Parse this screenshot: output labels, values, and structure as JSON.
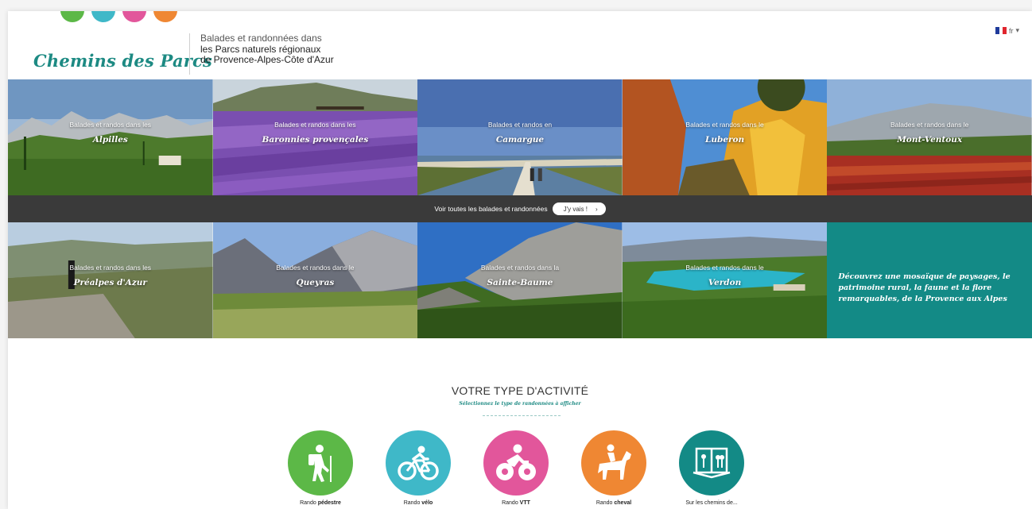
{
  "header": {
    "logo": "Chemins des Parcs",
    "tagline_1": "Balades et randonnées dans",
    "tagline_2": "les Parcs naturels régionaux",
    "tagline_3": "de Provence-Alpes-Côte d'Azur",
    "lang": "fr",
    "dots": [
      "#5cb847",
      "#3fb8c8",
      "#e2569b",
      "#ef8733"
    ]
  },
  "tiles_row1": [
    {
      "caption": "Balades et randos dans les",
      "name": "Alpilles"
    },
    {
      "caption": "Balades et randos dans les",
      "name": "Baronnies provençales"
    },
    {
      "caption": "Balades et randos en",
      "name": "Camargue"
    },
    {
      "caption": "Balades et randos dans le",
      "name": "Luberon"
    },
    {
      "caption": "Balades et randos dans le",
      "name": "Mont-Ventoux"
    }
  ],
  "band": {
    "text": "Voir toutes les balades et randonnées",
    "button": "J'y vais !",
    "chevron": "›"
  },
  "tiles_row2": [
    {
      "caption": "Balades et randos dans les",
      "name": "Préalpes d'Azur"
    },
    {
      "caption": "Balades et randos dans le",
      "name": "Queyras"
    },
    {
      "caption": "Balades et randos dans la",
      "name": "Sainte-Baume"
    },
    {
      "caption": "Balades et randos dans le",
      "name": "Verdon"
    }
  ],
  "promo": "Découvrez une mosaïque de paysages, le patrimoine rural, la faune et la flore remarquables, de la Provence aux Alpes",
  "activities": {
    "title": "VOTRE TYPE D'ACTIVITÉ",
    "subtitle": "Sélectionnez le type de randonnées à afficher",
    "items": [
      {
        "prefix": "Rando ",
        "bold": "pédestre",
        "color": "#5cb847",
        "icon": "hiker-icon"
      },
      {
        "prefix": "Rando ",
        "bold": "vélo",
        "color": "#3fb8c8",
        "icon": "bicycle-icon"
      },
      {
        "prefix": "Rando ",
        "bold": "VTT",
        "color": "#e2569b",
        "icon": "mountain-bike-icon"
      },
      {
        "prefix": "Rando ",
        "bold": "cheval",
        "color": "#ef8733",
        "icon": "horse-rider-icon"
      },
      {
        "prefix": "Sur les chemins de...",
        "bold": "",
        "color": "#138a86",
        "icon": "book-icon"
      }
    ]
  }
}
